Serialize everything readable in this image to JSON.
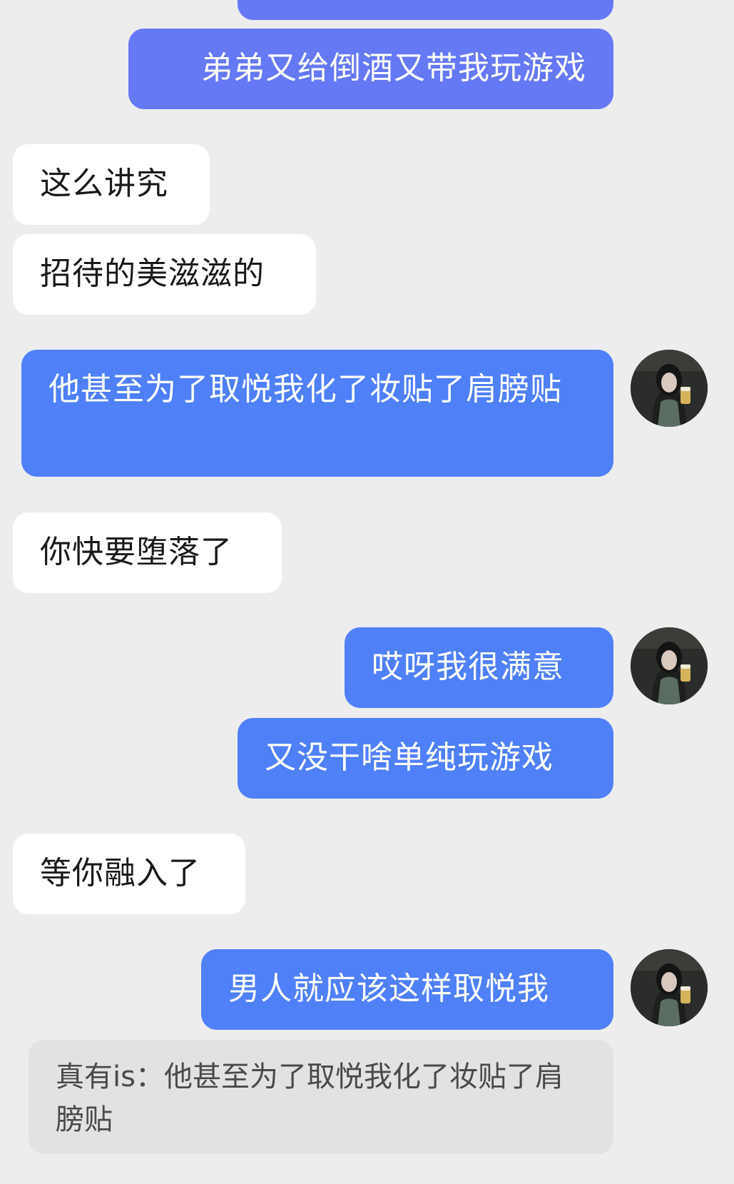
{
  "colors": {
    "background": "#ededed",
    "outgoing_bubble": "#4f80f7",
    "outgoing_bubble_alt": "#6679f4",
    "incoming_bubble": "#ffffff",
    "quote_bubble": "#e2e2e2"
  },
  "messages": [
    {
      "from": "me",
      "text": ""
    },
    {
      "from": "me",
      "text": "弟弟又给倒酒又带我玩游戏"
    },
    {
      "from": "other",
      "text": "这么讲究"
    },
    {
      "from": "other",
      "text": "招待的美滋滋的"
    },
    {
      "from": "me",
      "text": "他甚至为了取悦我化了妆贴了肩膀贴"
    },
    {
      "from": "other",
      "text": "你快要堕落了"
    },
    {
      "from": "me",
      "text": "哎呀我很满意"
    },
    {
      "from": "me",
      "text": "又没干啥单纯玩游戏"
    },
    {
      "from": "other",
      "text": "等你融入了"
    },
    {
      "from": "me",
      "text": "男人就应该这样取悦我"
    }
  ],
  "quote": {
    "text": "真有is：他甚至为了取悦我化了妆贴了肩膀贴"
  },
  "avatar": {
    "icon": "user-avatar-photo"
  }
}
